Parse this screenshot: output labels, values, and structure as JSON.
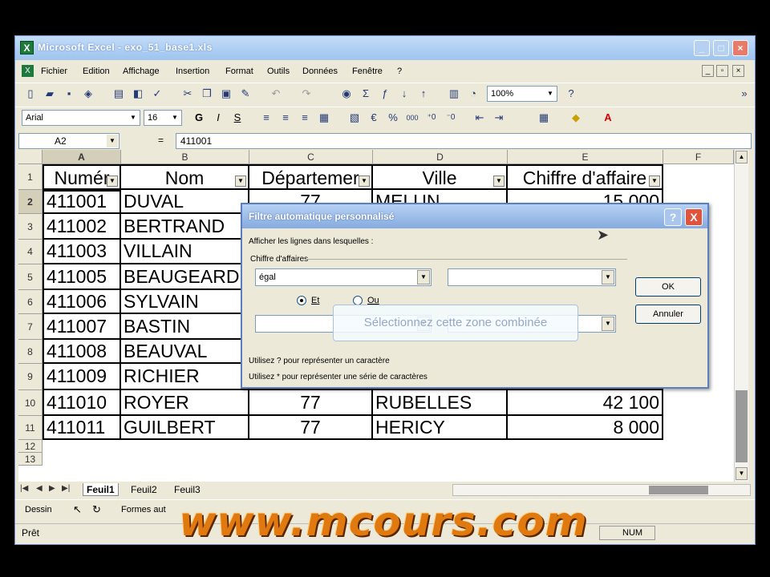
{
  "window": {
    "title": "Microsoft Excel - exo_51_base1.xls"
  },
  "menu": [
    "Fichier",
    "Edition",
    "Affichage",
    "Insertion",
    "Format",
    "Outils",
    "Données",
    "Fenêtre",
    "?"
  ],
  "toolbar": {
    "zoom": "100%"
  },
  "format_toolbar": {
    "font": "Arial",
    "size": "16"
  },
  "formula_bar": {
    "name_box": "A2",
    "eq": "=",
    "value": "411001"
  },
  "columns": [
    "A",
    "B",
    "C",
    "D",
    "E",
    "F"
  ],
  "rows": [
    "1",
    "2",
    "3",
    "4",
    "5",
    "6",
    "7",
    "8",
    "9",
    "10",
    "11",
    "12",
    "13"
  ],
  "headers": [
    "Numér",
    "Nom",
    "Départemer",
    "Ville",
    "Chiffre d'affaire"
  ],
  "table": [
    [
      "411001",
      "DUVAL",
      "77",
      "MELUN",
      "15 000"
    ],
    [
      "411002",
      "BERTRAND",
      "",
      "",
      ""
    ],
    [
      "411003",
      "VILLAIN",
      "",
      "",
      ""
    ],
    [
      "411005",
      "BEAUGEARD",
      "",
      "",
      ""
    ],
    [
      "411006",
      "SYLVAIN",
      "",
      "",
      ""
    ],
    [
      "411007",
      "BASTIN",
      "",
      "",
      ""
    ],
    [
      "411008",
      "BEAUVAL",
      "",
      "",
      ""
    ],
    [
      "411009",
      "RICHIER",
      "",
      "",
      ""
    ],
    [
      "411010",
      "ROYER",
      "77",
      "RUBELLES",
      "42 100"
    ],
    [
      "411011",
      "GUILBERT",
      "77",
      "HERICY",
      "8 000"
    ]
  ],
  "sheets": [
    "Feuil1",
    "Feuil2",
    "Feuil3"
  ],
  "drawbar": {
    "dessin": "Dessin",
    "formes": "Formes aut"
  },
  "status": {
    "ready": "Prêt",
    "num": "NUM"
  },
  "dialog": {
    "title": "Filtre automatique personnalisé",
    "instruction": "Afficher les lignes dans lesquelles :",
    "field": "Chiffre d'affaires",
    "operator1": "égal",
    "value1": "",
    "and_label": "Et",
    "or_label": "Ou",
    "operator2": "",
    "value2": "",
    "ok": "OK",
    "cancel": "Annuler",
    "hint1": "Utilisez ? pour représenter un caractère",
    "hint2": "Utilisez * pour représenter une série de caractères",
    "help": "?",
    "close": "X"
  },
  "tooltip": "Sélectionnez cette zone combinée",
  "watermark": "www.mcours.com"
}
